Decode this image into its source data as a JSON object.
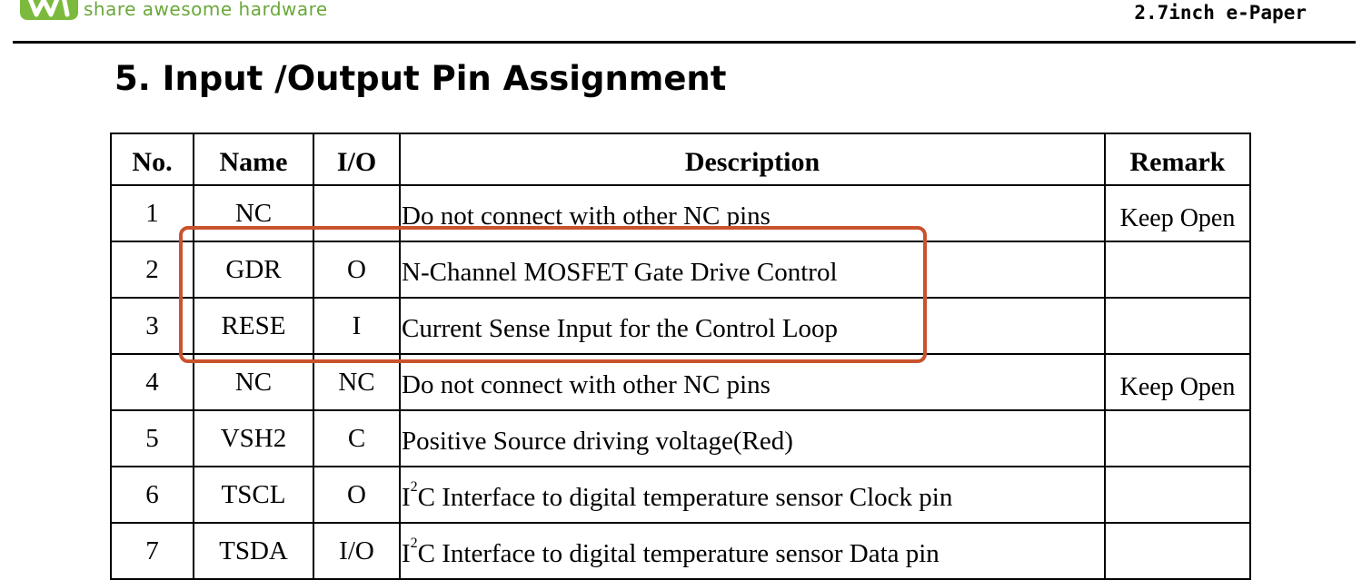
{
  "header": {
    "tagline": "share awesome hardware",
    "product": "2.7inch e-Paper",
    "logo_color": "#7cba3d"
  },
  "section": {
    "title": "5. Input /Output Pin Assignment"
  },
  "table": {
    "columns": [
      "No.",
      "Name",
      "I/O",
      "Description",
      "Remark"
    ],
    "rows": [
      {
        "no": "1",
        "name": "NC",
        "io": "",
        "desc_pre": "",
        "desc_sup": "",
        "desc": "Do not connect with other NC pins",
        "remark": "Keep Open"
      },
      {
        "no": "2",
        "name": "GDR",
        "io": "O",
        "desc_pre": "",
        "desc_sup": "",
        "desc": "N-Channel MOSFET Gate Drive Control",
        "remark": ""
      },
      {
        "no": "3",
        "name": "RESE",
        "io": "I",
        "desc_pre": "",
        "desc_sup": "",
        "desc": "Current Sense Input for the Control Loop",
        "remark": ""
      },
      {
        "no": "4",
        "name": "NC",
        "io": "NC",
        "desc_pre": "",
        "desc_sup": "",
        "desc": "Do not connect with other NC pins",
        "remark": "Keep Open"
      },
      {
        "no": "5",
        "name": "VSH2",
        "io": "C",
        "desc_pre": "",
        "desc_sup": "",
        "desc": "Positive Source driving voltage(Red)",
        "remark": ""
      },
      {
        "no": "6",
        "name": "TSCL",
        "io": "O",
        "desc_pre": "I",
        "desc_sup": "2",
        "desc": "C Interface to digital temperature sensor Clock pin",
        "remark": ""
      },
      {
        "no": "7",
        "name": "TSDA",
        "io": "I/O",
        "desc_pre": "I",
        "desc_sup": "2",
        "desc": "C Interface to digital temperature sensor Data pin",
        "remark": ""
      }
    ]
  },
  "annotation": {
    "highlight_color": "#c9532d",
    "highlighted_rows": [
      "2",
      "3"
    ]
  }
}
